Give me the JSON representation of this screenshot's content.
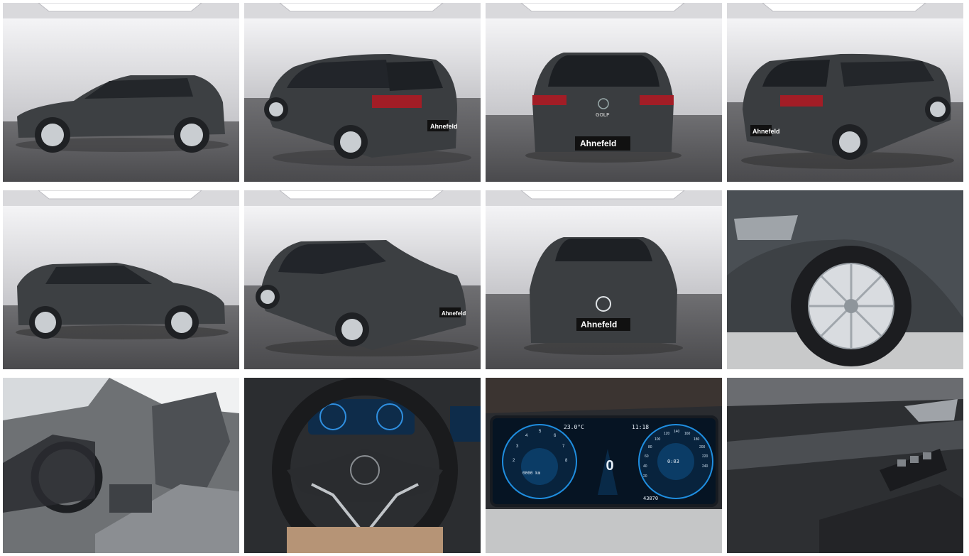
{
  "gallery": {
    "plate_text": "Ahnefeld",
    "badge_text": "GOLF",
    "cluster": {
      "temperature": "23.0°C",
      "time": "11:18",
      "speed": "0",
      "odometer": "43870",
      "left_tick_labels": [
        "2",
        "3",
        "4",
        "5",
        "6",
        "7",
        "8"
      ],
      "right_tick_labels": [
        "20",
        "40",
        "60",
        "80",
        "100",
        "120",
        "140",
        "160",
        "180",
        "200",
        "220",
        "240"
      ],
      "left_readout": "0000 km",
      "right_readout": "0:03"
    }
  }
}
